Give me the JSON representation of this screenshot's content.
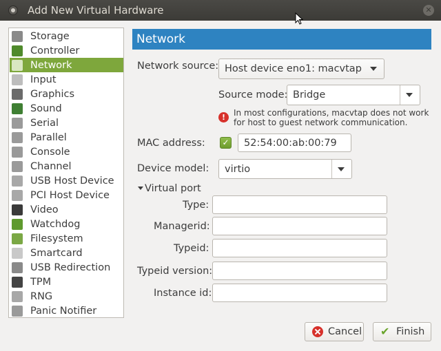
{
  "window": {
    "title": "Add New Virtual Hardware"
  },
  "sidebar": {
    "items": [
      {
        "label": "Storage",
        "icon": "disk-icon",
        "color": "#8a8a8a"
      },
      {
        "label": "Controller",
        "icon": "controller-icon",
        "color": "#4f8a2b"
      },
      {
        "label": "Network",
        "icon": "network-icon",
        "color": "#d9e7c2"
      },
      {
        "label": "Input",
        "icon": "mouse-icon",
        "color": "#bdbdbd"
      },
      {
        "label": "Graphics",
        "icon": "monitor-icon",
        "color": "#6b6b6b"
      },
      {
        "label": "Sound",
        "icon": "sound-card-icon",
        "color": "#3f7f33"
      },
      {
        "label": "Serial",
        "icon": "serial-icon",
        "color": "#9a9a9a"
      },
      {
        "label": "Parallel",
        "icon": "parallel-icon",
        "color": "#9a9a9a"
      },
      {
        "label": "Console",
        "icon": "console-icon",
        "color": "#9a9a9a"
      },
      {
        "label": "Channel",
        "icon": "channel-icon",
        "color": "#9a9a9a"
      },
      {
        "label": "USB Host Device",
        "icon": "usb-icon",
        "color": "#a8a8a8"
      },
      {
        "label": "PCI Host Device",
        "icon": "pci-icon",
        "color": "#a8a8a8"
      },
      {
        "label": "Video",
        "icon": "video-icon",
        "color": "#3a3a3a"
      },
      {
        "label": "Watchdog",
        "icon": "watchdog-icon",
        "color": "#5f9a2e"
      },
      {
        "label": "Filesystem",
        "icon": "folder-icon",
        "color": "#7ba845"
      },
      {
        "label": "Smartcard",
        "icon": "smartcard-icon",
        "color": "#c9c9c9"
      },
      {
        "label": "USB Redirection",
        "icon": "usb-redirect-icon",
        "color": "#8a8a8a"
      },
      {
        "label": "TPM",
        "icon": "chip-icon",
        "color": "#444444"
      },
      {
        "label": "RNG",
        "icon": "rng-icon",
        "color": "#a8a8a8"
      },
      {
        "label": "Panic Notifier",
        "icon": "panic-icon",
        "color": "#9a9a9a"
      }
    ],
    "selected_index": 2
  },
  "header": {
    "title": "Network"
  },
  "form": {
    "network_source_label": "Network source:",
    "network_source_value": "Host device eno1: macvtap",
    "source_mode_label": "Source mode:",
    "source_mode_value": "Bridge",
    "warning_line1": "In most configurations, macvtap does not work",
    "warning_line2": "for host to guest network communication.",
    "mac_label": "MAC address:",
    "mac_checkbox_checked": true,
    "mac_value": "52:54:00:ab:00:79",
    "device_model_label": "Device model:",
    "device_model_value": "virtio",
    "virtual_port_label": "Virtual port",
    "type_label": "Type:",
    "type_value": "",
    "managerid_label": "Managerid:",
    "managerid_value": "",
    "typeid_label": "Typeid:",
    "typeid_value": "",
    "typeid_version_label": "Typeid version:",
    "typeid_version_value": "",
    "instance_id_label": "Instance id:",
    "instance_id_value": ""
  },
  "buttons": {
    "cancel": "Cancel",
    "finish": "Finish"
  },
  "colors": {
    "selected": "#7ea73c",
    "header": "#2e83c1"
  }
}
